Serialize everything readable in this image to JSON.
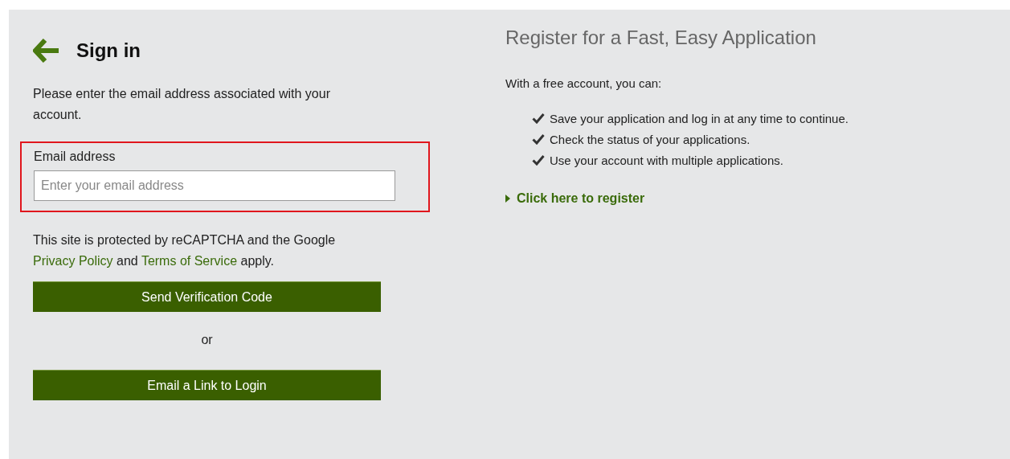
{
  "signin": {
    "title": "Sign in",
    "intro": "Please enter the email address associated with your account.",
    "email": {
      "label": "Email address",
      "placeholder": "Enter your email address",
      "highlighted": true
    },
    "recaptcha": {
      "text": "This site is protected by reCAPTCHA and the Google",
      "privacy": "Privacy Policy",
      "and": "and",
      "terms": "Terms of Service",
      "apply": "apply."
    },
    "send_button": "Send Verification Code",
    "or": "or",
    "link_button": "Email a Link to Login"
  },
  "register": {
    "title": "Register for a Fast, Easy Application",
    "intro": "With a free account, you can:",
    "benefits": [
      "Save your application and log in at any time to continue.",
      "Check the status of your applications.",
      "Use your account with multiple applications."
    ],
    "link": "Click here to register"
  }
}
